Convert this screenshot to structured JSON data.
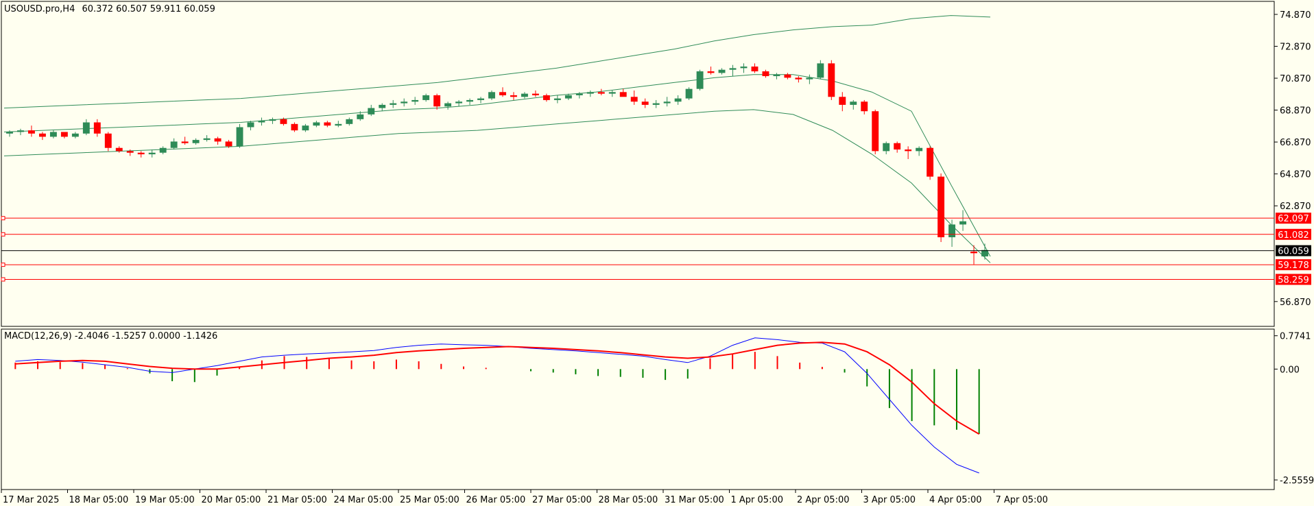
{
  "header": {
    "symbol": "USOUSD.pro,H4",
    "ohlc": "60.372 60.507 59.911 60.059"
  },
  "chart_data": {
    "type": "candlestick",
    "price_panel": {
      "y_ticks": [
        74.87,
        72.87,
        70.87,
        68.87,
        66.87,
        64.87,
        62.87,
        56.87
      ],
      "y_tick_labels": [
        "74.870",
        "72.870",
        "70.870",
        "68.870",
        "66.870",
        "64.870",
        "62.870",
        "56.870"
      ],
      "ylim": [
        55.4,
        75.6
      ],
      "current_price": 60.059,
      "current_price_label": "60.059",
      "levels": [
        {
          "value": 62.097,
          "label": "62.097"
        },
        {
          "value": 61.082,
          "label": "61.082"
        },
        {
          "value": 59.178,
          "label": "59.178"
        },
        {
          "value": 58.259,
          "label": "58.259"
        }
      ],
      "candles": [
        [
          67.4,
          67.6,
          67.2,
          67.5
        ],
        [
          67.5,
          67.7,
          67.3,
          67.6
        ],
        [
          67.6,
          67.9,
          67.2,
          67.4
        ],
        [
          67.4,
          67.5,
          67.0,
          67.2
        ],
        [
          67.2,
          67.6,
          67.1,
          67.5
        ],
        [
          67.5,
          67.4,
          67.1,
          67.2
        ],
        [
          67.2,
          67.5,
          67.1,
          67.4
        ],
        [
          67.4,
          68.3,
          67.3,
          68.1
        ],
        [
          68.1,
          68.3,
          67.2,
          67.4
        ],
        [
          67.4,
          67.5,
          66.3,
          66.5
        ],
        [
          66.5,
          66.6,
          66.2,
          66.3
        ],
        [
          66.3,
          66.4,
          66.0,
          66.2
        ],
        [
          66.2,
          66.3,
          65.9,
          66.1
        ],
        [
          66.1,
          66.4,
          65.9,
          66.2
        ],
        [
          66.2,
          66.6,
          66.1,
          66.5
        ],
        [
          66.5,
          67.1,
          66.4,
          66.9
        ],
        [
          66.9,
          67.2,
          66.7,
          66.8
        ],
        [
          66.8,
          67.1,
          66.7,
          67.0
        ],
        [
          67.0,
          67.3,
          66.9,
          67.1
        ],
        [
          67.1,
          67.2,
          66.7,
          66.9
        ],
        [
          66.9,
          67.0,
          66.5,
          66.6
        ],
        [
          66.6,
          68.0,
          66.5,
          67.8
        ],
        [
          67.8,
          68.2,
          67.6,
          68.1
        ],
        [
          68.1,
          68.4,
          67.9,
          68.2
        ],
        [
          68.2,
          68.4,
          68.0,
          68.3
        ],
        [
          68.3,
          68.4,
          67.9,
          68.0
        ],
        [
          68.0,
          68.1,
          67.5,
          67.6
        ],
        [
          67.6,
          68.0,
          67.5,
          67.9
        ],
        [
          67.9,
          68.2,
          67.8,
          68.1
        ],
        [
          68.1,
          68.2,
          67.8,
          67.9
        ],
        [
          67.9,
          68.2,
          67.8,
          68.0
        ],
        [
          68.0,
          68.4,
          67.9,
          68.3
        ],
        [
          68.3,
          68.8,
          68.2,
          68.6
        ],
        [
          68.6,
          69.2,
          68.5,
          69.0
        ],
        [
          69.0,
          69.3,
          68.8,
          69.2
        ],
        [
          69.2,
          69.5,
          69.0,
          69.3
        ],
        [
          69.3,
          69.6,
          69.1,
          69.4
        ],
        [
          69.4,
          69.7,
          69.2,
          69.5
        ],
        [
          69.5,
          69.9,
          69.4,
          69.8
        ],
        [
          69.8,
          69.9,
          68.9,
          69.1
        ],
        [
          69.1,
          69.4,
          68.9,
          69.3
        ],
        [
          69.3,
          69.5,
          69.1,
          69.4
        ],
        [
          69.4,
          69.6,
          69.2,
          69.5
        ],
        [
          69.5,
          69.7,
          69.3,
          69.6
        ],
        [
          69.6,
          70.1,
          69.5,
          70.0
        ],
        [
          70.0,
          70.3,
          69.7,
          69.8
        ],
        [
          69.8,
          70.0,
          69.5,
          69.7
        ],
        [
          69.7,
          70.0,
          69.6,
          69.9
        ],
        [
          69.9,
          70.1,
          69.7,
          69.8
        ],
        [
          69.8,
          69.9,
          69.4,
          69.5
        ],
        [
          69.5,
          69.8,
          69.3,
          69.6
        ],
        [
          69.6,
          69.9,
          69.5,
          69.8
        ],
        [
          69.8,
          70.0,
          69.6,
          69.9
        ],
        [
          69.9,
          70.1,
          69.7,
          70.0
        ],
        [
          70.0,
          70.2,
          69.8,
          69.9
        ],
        [
          69.9,
          70.1,
          69.7,
          70.0
        ],
        [
          70.0,
          70.2,
          69.8,
          69.7
        ],
        [
          69.7,
          70.1,
          69.2,
          69.4
        ],
        [
          69.4,
          69.6,
          69.0,
          69.2
        ],
        [
          69.2,
          69.5,
          69.0,
          69.3
        ],
        [
          69.3,
          69.7,
          69.1,
          69.4
        ],
        [
          69.4,
          69.8,
          69.2,
          69.6
        ],
        [
          69.6,
          70.3,
          69.5,
          70.2
        ],
        [
          70.2,
          71.4,
          70.1,
          71.3
        ],
        [
          71.3,
          71.6,
          71.1,
          71.2
        ],
        [
          71.2,
          71.5,
          71.1,
          71.4
        ],
        [
          71.4,
          71.7,
          71.0,
          71.5
        ],
        [
          71.5,
          71.8,
          71.2,
          71.6
        ],
        [
          71.6,
          71.8,
          71.2,
          71.3
        ],
        [
          71.3,
          71.4,
          70.9,
          71.0
        ],
        [
          71.0,
          71.2,
          70.8,
          71.1
        ],
        [
          71.1,
          71.2,
          70.8,
          70.9
        ],
        [
          70.9,
          71.0,
          70.6,
          70.8
        ],
        [
          70.8,
          71.1,
          70.5,
          70.9
        ],
        [
          70.9,
          72.0,
          70.8,
          71.8
        ],
        [
          71.8,
          72.0,
          69.5,
          69.7
        ],
        [
          69.7,
          70.0,
          68.8,
          69.2
        ],
        [
          69.2,
          69.5,
          68.9,
          69.4
        ],
        [
          69.4,
          69.5,
          68.6,
          68.8
        ],
        [
          68.8,
          68.9,
          66.1,
          66.3
        ],
        [
          66.3,
          66.9,
          66.1,
          66.8
        ],
        [
          66.8,
          66.9,
          66.2,
          66.4
        ],
        [
          66.4,
          66.6,
          65.8,
          66.3
        ],
        [
          66.3,
          66.6,
          66.0,
          66.5
        ],
        [
          66.5,
          66.6,
          64.5,
          64.7
        ],
        [
          64.7,
          64.9,
          60.6,
          60.9
        ],
        [
          60.9,
          62.0,
          60.3,
          61.7
        ],
        [
          61.7,
          62.6,
          61.3,
          61.9
        ],
        [
          60.0,
          60.4,
          59.2,
          59.9
        ],
        [
          59.7,
          60.5,
          59.5,
          60.1
        ]
      ],
      "bollinger": {
        "upper": [
          69.0,
          69.1,
          69.2,
          69.3,
          69.4,
          69.5,
          69.6,
          69.8,
          70.0,
          70.2,
          70.4,
          70.6,
          70.9,
          71.2,
          71.5,
          71.9,
          72.3,
          72.7,
          73.2,
          73.6,
          73.9,
          74.1,
          74.2,
          74.6,
          74.8,
          74.7
        ],
        "middle": [
          67.5,
          67.6,
          67.7,
          67.8,
          67.9,
          68.0,
          68.1,
          68.3,
          68.5,
          68.7,
          68.9,
          69.0,
          69.2,
          69.5,
          69.8,
          70.0,
          70.3,
          70.6,
          70.9,
          71.1,
          71.1,
          70.7,
          70.0,
          68.8,
          64.2,
          59.7
        ],
        "lower": [
          66.0,
          66.1,
          66.2,
          66.3,
          66.4,
          66.5,
          66.6,
          66.8,
          67.0,
          67.2,
          67.4,
          67.5,
          67.6,
          67.8,
          68.0,
          68.2,
          68.4,
          68.6,
          68.8,
          68.9,
          68.6,
          67.6,
          66.1,
          64.3,
          61.7,
          59.3
        ]
      }
    },
    "macd_panel": {
      "title": "MACD(12,26,9) -2.4046 -1.5257 0.0000 -1.1426",
      "y_tick_labels": [
        "0.7741",
        "0.00",
        "-2.5559"
      ],
      "ylim": [
        -2.75,
        0.86
      ],
      "macd": [
        0.18,
        0.22,
        0.2,
        0.16,
        0.1,
        0.04,
        -0.05,
        -0.08,
        0.0,
        0.08,
        0.18,
        0.28,
        0.32,
        0.35,
        0.37,
        0.4,
        0.43,
        0.5,
        0.55,
        0.58,
        0.56,
        0.55,
        0.52,
        0.48,
        0.45,
        0.42,
        0.38,
        0.34,
        0.3,
        0.22,
        0.15,
        0.3,
        0.55,
        0.72,
        0.68,
        0.62,
        0.6,
        0.4,
        -0.1,
        -0.7,
        -1.3,
        -1.8,
        -2.2,
        -2.4
      ],
      "signal": [
        0.12,
        0.15,
        0.18,
        0.2,
        0.18,
        0.12,
        0.06,
        0.02,
        0.0,
        0.0,
        0.05,
        0.1,
        0.15,
        0.2,
        0.25,
        0.28,
        0.32,
        0.38,
        0.42,
        0.45,
        0.48,
        0.5,
        0.52,
        0.5,
        0.48,
        0.45,
        0.42,
        0.38,
        0.33,
        0.28,
        0.25,
        0.28,
        0.35,
        0.45,
        0.55,
        0.6,
        0.62,
        0.58,
        0.4,
        0.1,
        -0.3,
        -0.8,
        -1.2,
        -1.5
      ],
      "histogram": [
        0.15,
        0.18,
        0.16,
        0.14,
        0.1,
        0.02,
        -0.1,
        -0.28,
        -0.3,
        -0.15,
        0.05,
        0.2,
        0.3,
        0.28,
        0.24,
        0.2,
        0.18,
        0.22,
        0.18,
        0.12,
        0.06,
        0.03,
        0.0,
        -0.05,
        -0.08,
        -0.12,
        -0.16,
        -0.18,
        -0.2,
        -0.25,
        -0.22,
        0.25,
        0.35,
        0.4,
        0.3,
        0.15,
        0.05,
        -0.08,
        -0.4,
        -0.9,
        -1.2,
        -1.3,
        -1.4,
        -1.5
      ]
    },
    "x_labels": [
      "17 Mar 2025",
      "18 Mar 05:00",
      "19 Mar 05:00",
      "20 Mar 05:00",
      "21 Mar 05:00",
      "24 Mar 05:00",
      "25 Mar 05:00",
      "26 Mar 05:00",
      "27 Mar 05:00",
      "28 Mar 05:00",
      "31 Mar 05:00",
      "1 Apr 05:00",
      "2 Apr 05:00",
      "3 Apr 05:00",
      "4 Apr 05:00",
      "7 Apr 05:00"
    ],
    "colors": {
      "bull": "#2e8b57",
      "bear": "#ff0000",
      "bands": "#2e8b57",
      "macd": "#0000ff",
      "signal": "#ff0000",
      "level": "#ff0000",
      "bg": "#fffff0"
    }
  }
}
